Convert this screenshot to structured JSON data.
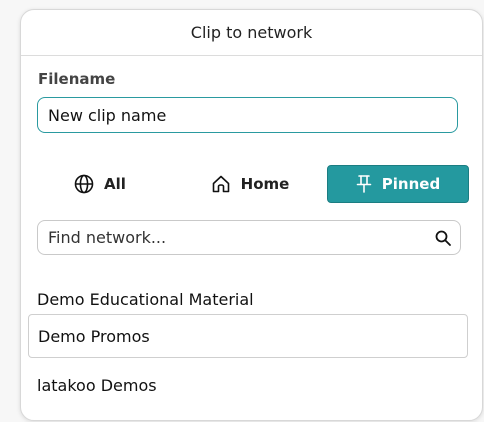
{
  "dialog": {
    "title": "Clip to network"
  },
  "filename": {
    "label": "Filename",
    "value": "New clip name"
  },
  "tabs": [
    {
      "label": "All",
      "icon": "globe-icon",
      "selected": false
    },
    {
      "label": "Home",
      "icon": "home-icon",
      "selected": false
    },
    {
      "label": "Pinned",
      "icon": "pin-icon",
      "selected": true
    }
  ],
  "search": {
    "placeholder": "Find network..."
  },
  "networks": [
    {
      "label": "Demo Educational Material"
    },
    {
      "label": "Demo Promos"
    },
    {
      "label": "latakoo Demos"
    }
  ],
  "colors": {
    "accent": "#24999f",
    "accent_border": "#2a9aa0"
  }
}
